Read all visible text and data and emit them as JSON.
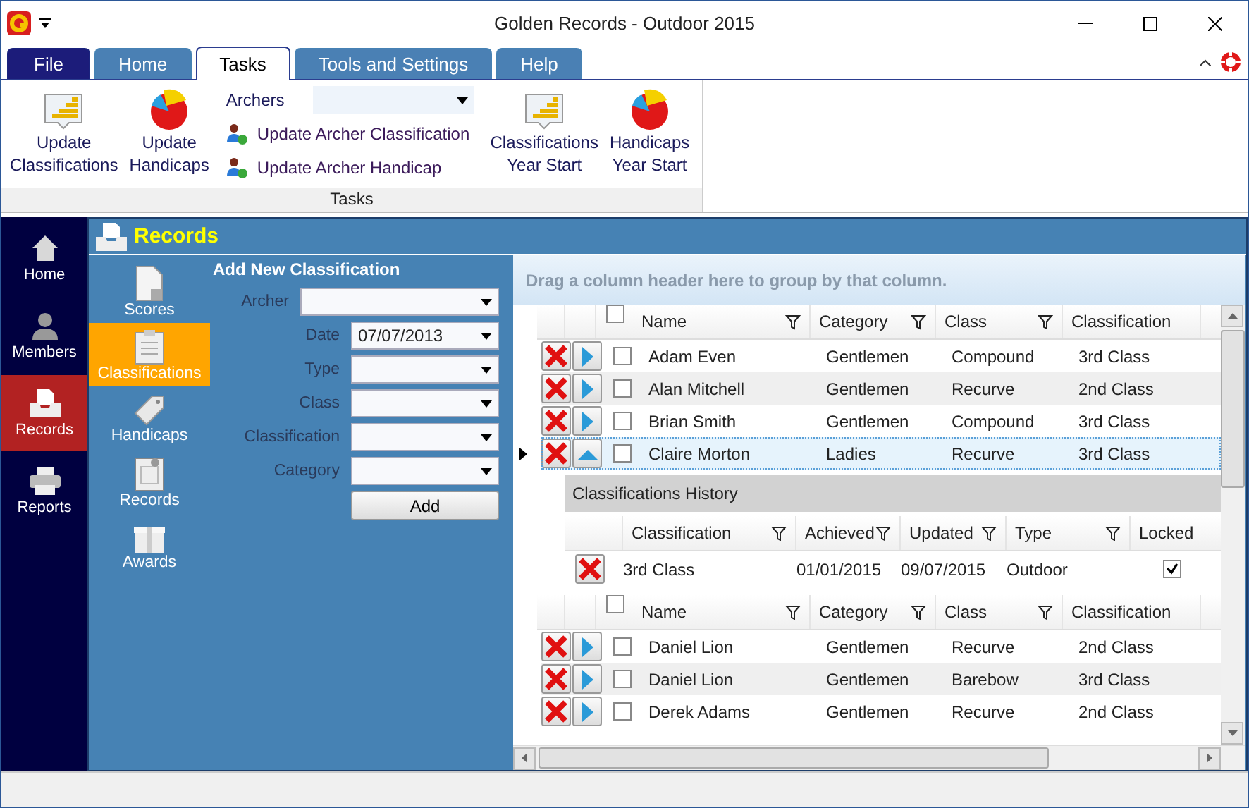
{
  "window": {
    "title": "Golden Records - Outdoor 2015"
  },
  "ribbon_tabs": [
    {
      "label": "File",
      "kind": "file",
      "selected": false
    },
    {
      "label": "Home",
      "kind": "tab",
      "selected": false
    },
    {
      "label": "Tasks",
      "kind": "tab",
      "selected": true
    },
    {
      "label": "Tools and Settings",
      "kind": "tab",
      "selected": false
    },
    {
      "label": "Help",
      "kind": "tab",
      "selected": false
    }
  ],
  "ribbon": {
    "group": "Tasks",
    "left_buttons": [
      {
        "lines": [
          "Update",
          "Classifications"
        ],
        "kind": "bars"
      },
      {
        "lines": [
          "Update",
          "Handicaps"
        ],
        "kind": "pie"
      }
    ],
    "archers": {
      "label": "Archers"
    },
    "links": [
      "Update Archer Classification",
      "Update Archer Handicap"
    ],
    "right_buttons": [
      {
        "lines": [
          "Classifications",
          "Year Start"
        ],
        "kind": "bars"
      },
      {
        "lines": [
          "Handicaps",
          "Year Start"
        ],
        "kind": "pie"
      }
    ]
  },
  "nav": [
    {
      "label": "Home",
      "kind": "home",
      "selected": false
    },
    {
      "label": "Members",
      "kind": "person",
      "selected": false
    },
    {
      "label": "Records",
      "kind": "tray",
      "selected": true
    },
    {
      "label": "Reports",
      "kind": "printer",
      "selected": false
    }
  ],
  "header": "Records",
  "subnav": [
    {
      "label": "Scores",
      "kind": "document",
      "selected": false
    },
    {
      "label": "Classifications",
      "kind": "clipboard",
      "selected": true
    },
    {
      "label": "Handicaps",
      "kind": "tag",
      "selected": false
    },
    {
      "label": "Records",
      "kind": "certificate",
      "selected": false
    },
    {
      "label": "Awards",
      "kind": "gift",
      "selected": false
    }
  ],
  "form": {
    "title": "Add New Classification",
    "fields": [
      {
        "label": "Archer",
        "kind": "wide"
      },
      {
        "label": "Date",
        "value": "07/07/2013",
        "kind": "narrow"
      },
      {
        "label": "Type",
        "kind": "narrow"
      },
      {
        "label": "Class",
        "kind": "narrow"
      },
      {
        "label": "Classification",
        "kind": "narrow"
      },
      {
        "label": "Category",
        "kind": "narrow"
      }
    ],
    "button": "Add"
  },
  "grid": {
    "group_hint": "Drag a column header here to group by that column.",
    "select_all": false,
    "columns": [
      "Name",
      "Category",
      "Class",
      "Classification"
    ],
    "rows": [
      {
        "cells": [
          "Adam Even",
          "Gentlemen",
          "Compound",
          "3rd Class"
        ],
        "checked": false,
        "expanded": false,
        "current": false
      },
      {
        "cells": [
          "Alan Mitchell",
          "Gentlemen",
          "Recurve",
          "2nd Class"
        ],
        "checked": false,
        "expanded": false,
        "current": false
      },
      {
        "cells": [
          "Brian Smith",
          "Gentlemen",
          "Compound",
          "3rd Class"
        ],
        "checked": false,
        "expanded": false,
        "current": false
      },
      {
        "cells": [
          "Claire Morton",
          "Ladies",
          "Recurve",
          "3rd Class"
        ],
        "checked": false,
        "expanded": true,
        "current": true
      }
    ],
    "detail": {
      "title": "Classifications History",
      "columns": [
        "Classification",
        "Achieved",
        "Updated",
        "Type",
        "Locked"
      ],
      "rows": [
        {
          "cells": [
            "3rd Class",
            "01/01/2015",
            "09/07/2015",
            "Outdoor"
          ],
          "locked": true
        }
      ]
    },
    "select_all_2": false,
    "columns_2": [
      "Name",
      "Category",
      "Class",
      "Classification"
    ],
    "rows_2": [
      {
        "cells": [
          "Daniel Lion",
          "Gentlemen",
          "Recurve",
          "2nd Class"
        ],
        "checked": false,
        "expanded": false,
        "current": false
      },
      {
        "cells": [
          "Daniel Lion",
          "Gentlemen",
          "Barebow",
          "3rd Class"
        ],
        "checked": false,
        "expanded": false,
        "current": false
      },
      {
        "cells": [
          "Derek Adams",
          "Gentlemen",
          "Recurve",
          "2nd Class"
        ],
        "checked": false,
        "expanded": false,
        "current": false
      }
    ]
  }
}
